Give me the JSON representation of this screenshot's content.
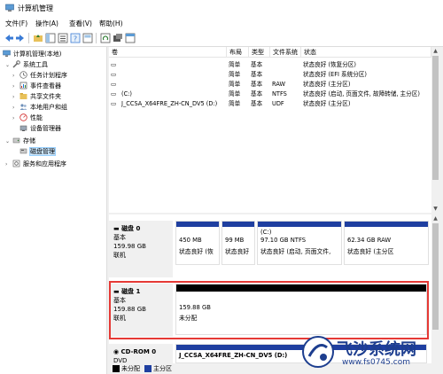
{
  "window": {
    "title": "计算机管理"
  },
  "menu": {
    "file": "文件(F)",
    "action": "操作(A)",
    "view": "查看(V)",
    "help": "帮助(H)"
  },
  "tree": {
    "root": "计算机管理(本地)",
    "system_tools": "系统工具",
    "task_scheduler": "任务计划程序",
    "event_viewer": "事件查看器",
    "shared_folders": "共享文件夹",
    "local_users": "本地用户和组",
    "performance": "性能",
    "device_manager": "设备管理器",
    "storage": "存储",
    "disk_management": "磁盘管理",
    "services": "服务和应用程序"
  },
  "volume_list": {
    "columns": {
      "volume": "卷",
      "layout": "布局",
      "type": "类型",
      "fs": "文件系统",
      "status": "状态"
    },
    "rows": [
      {
        "volume": "",
        "layout": "简单",
        "type": "基本",
        "fs": "",
        "status": "状态良好 (恢复分区)"
      },
      {
        "volume": "",
        "layout": "简单",
        "type": "基本",
        "fs": "",
        "status": "状态良好 (EFI 系统分区)"
      },
      {
        "volume": "",
        "layout": "简单",
        "type": "基本",
        "fs": "RAW",
        "status": "状态良好 (主分区)"
      },
      {
        "volume": "(C:)",
        "layout": "简单",
        "type": "基本",
        "fs": "NTFS",
        "status": "状态良好 (启动, 页面文件, 故障转储, 主分区)"
      },
      {
        "volume": "J_CCSA_X64FRE_ZH-CN_DV5 (D:)",
        "layout": "简单",
        "type": "基本",
        "fs": "UDF",
        "status": "状态良好 (主分区)"
      }
    ]
  },
  "disks": [
    {
      "name": "磁盘 0",
      "type": "基本",
      "size": "159.98 GB",
      "state": "联机",
      "partitions": [
        {
          "line1": "",
          "line2": "450 MB",
          "line3": "状态良好 (恢"
        },
        {
          "line1": "",
          "line2": "99 MB",
          "line3": "状态良好"
        },
        {
          "line1": "(C:)",
          "line2": "97.10 GB NTFS",
          "line3": "状态良好 (启动, 页面文件,"
        },
        {
          "line1": "",
          "line2": "62.34 GB RAW",
          "line3": "状态良好 (主分区"
        }
      ]
    },
    {
      "name": "磁盘 1",
      "type": "基本",
      "size": "159.88 GB",
      "state": "联机",
      "partitions": [
        {
          "line1": "",
          "line2": "159.88 GB",
          "line3": "未分配"
        }
      ]
    },
    {
      "name": "CD-ROM 0",
      "type": "DVD",
      "size": "",
      "state": "",
      "partitions": [
        {
          "line1": "J_CCSA_X64FRE_ZH-CN_DV5 (D:)",
          "line2": "",
          "line3": ""
        }
      ]
    }
  ],
  "legend": {
    "unallocated": "未分配",
    "primary": "主分区"
  },
  "watermark": {
    "brand": "飞沙系统网",
    "url": "www.fs0745.com"
  },
  "colors": {
    "primary_bar": "#1f3fa0",
    "unallocated_bar": "#000000",
    "highlight": "#e53935"
  }
}
